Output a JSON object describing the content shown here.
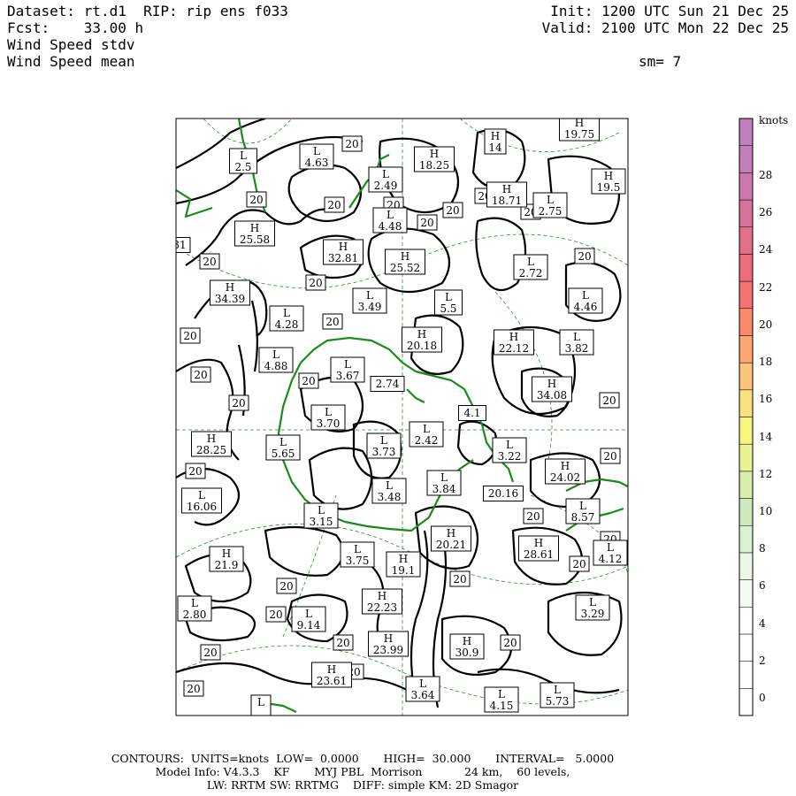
{
  "header": {
    "dataset_line": "Dataset: rt.d1  RIP: rip ens f033",
    "fcst_line": "Fcst:    33.00 h",
    "field1": "Wind Speed stdv",
    "field2": "Wind Speed mean",
    "init_line": "Init: 1200 UTC Sun 21 Dec 25",
    "valid_line": "Valid: 2100 UTC Mon 22 Dec 25",
    "sm_line": "sm= 7"
  },
  "footer": {
    "line1": "CONTOURS:  UNITS=knots  LOW=  0.0000       HIGH=  30.000       INTERVAL=   5.0000",
    "line2": "Model Info: V4.3.3    KF       MYJ PBL  Morrison            24 km,    60 levels,",
    "line3": "LW: RRTM SW: RRTMG    DIFF: simple KM: 2D Smagor"
  },
  "colorbar": {
    "units": "knots",
    "ticks": [
      "0",
      "2",
      "4",
      "6",
      "8",
      "10",
      "12",
      "14",
      "16",
      "18",
      "20",
      "22",
      "24",
      "26",
      "28"
    ],
    "colors": [
      "#ffffff",
      "#ffffff",
      "#ffffff",
      "#ffffff",
      "#f4fbf3",
      "#eaf7e6",
      "#daf1d2",
      "#cde9bd",
      "#d9eeaa",
      "#e8f394",
      "#f6f57e",
      "#fce07e",
      "#fcc47a",
      "#fca772",
      "#fb8a6b",
      "#f77373",
      "#ec6c79",
      "#e26f8a",
      "#d7729b",
      "#cc78ac",
      "#c47fba",
      "#c080c0"
    ],
    "accent_border": "#000000"
  },
  "contour_labels": [
    "20",
    "20",
    "20",
    "20",
    "20",
    "20",
    "20",
    "20",
    "20",
    "20",
    "20",
    "20",
    "20",
    "20",
    "20",
    "20",
    "20",
    "20",
    "20",
    "20",
    "20",
    "20",
    "20",
    "20",
    "20",
    "20",
    "20",
    "20",
    "20",
    "20"
  ],
  "hl_markers": [
    {
      "kind": "L",
      "value": "2.5"
    },
    {
      "kind": "L",
      "value": "4.63"
    },
    {
      "kind": "H",
      "value": "18.25"
    },
    {
      "kind": "H",
      "value": "14"
    },
    {
      "kind": "H",
      "value": "19.75"
    },
    {
      "kind": "L",
      "value": "2.49"
    },
    {
      "kind": "H",
      "value": "18.71"
    },
    {
      "kind": "L",
      "value": "2.75"
    },
    {
      "kind": "H",
      "value": "19.5"
    },
    {
      "kind": "L",
      "value": "4.48"
    },
    {
      "kind": "H",
      "value": "25.58"
    },
    {
      "kind": "",
      "value": "31"
    },
    {
      "kind": "H",
      "value": "32.81"
    },
    {
      "kind": "H",
      "value": "25.52"
    },
    {
      "kind": "L",
      "value": "2.72"
    },
    {
      "kind": "H",
      "value": "34.39"
    },
    {
      "kind": "L",
      "value": "3.49"
    },
    {
      "kind": "L",
      "value": "5.5"
    },
    {
      "kind": "L",
      "value": "4.46"
    },
    {
      "kind": "L",
      "value": "4.28"
    },
    {
      "kind": "H",
      "value": "20.18"
    },
    {
      "kind": "H",
      "value": "22.12"
    },
    {
      "kind": "L",
      "value": "3.82"
    },
    {
      "kind": "L",
      "value": "4.88"
    },
    {
      "kind": "L",
      "value": "3.67"
    },
    {
      "kind": "",
      "value": "2.74"
    },
    {
      "kind": "H",
      "value": "34.08"
    },
    {
      "kind": "L",
      "value": "3.70"
    },
    {
      "kind": "",
      "value": "4.1"
    },
    {
      "kind": "H",
      "value": "28.25"
    },
    {
      "kind": "L",
      "value": "5.65"
    },
    {
      "kind": "L",
      "value": "3.73"
    },
    {
      "kind": "L",
      "value": "2.42"
    },
    {
      "kind": "L",
      "value": "3.22"
    },
    {
      "kind": "H",
      "value": "24.02"
    },
    {
      "kind": "L",
      "value": "3.84"
    },
    {
      "kind": "",
      "value": "20.16"
    },
    {
      "kind": "L",
      "value": "16.06"
    },
    {
      "kind": "L",
      "value": "3.48"
    },
    {
      "kind": "L",
      "value": "3.15"
    },
    {
      "kind": "L",
      "value": "8.57"
    },
    {
      "kind": "H",
      "value": "20.21"
    },
    {
      "kind": "H",
      "value": "28.61"
    },
    {
      "kind": "L",
      "value": "4.12"
    },
    {
      "kind": "H",
      "value": "21.9"
    },
    {
      "kind": "L",
      "value": "3.75"
    },
    {
      "kind": "H",
      "value": "19.1"
    },
    {
      "kind": "H",
      "value": "22.23"
    },
    {
      "kind": "L",
      "value": "2.80"
    },
    {
      "kind": "L",
      "value": "9.14"
    },
    {
      "kind": "L",
      "value": "3.29"
    },
    {
      "kind": "H",
      "value": "23.99"
    },
    {
      "kind": "H",
      "value": "30.9"
    },
    {
      "kind": "H",
      "value": "23.61"
    },
    {
      "kind": "L",
      "value": "3.64"
    },
    {
      "kind": "L",
      "value": "4.15"
    },
    {
      "kind": "L",
      "value": "5.73"
    },
    {
      "kind": "L",
      "value": ""
    }
  ]
}
